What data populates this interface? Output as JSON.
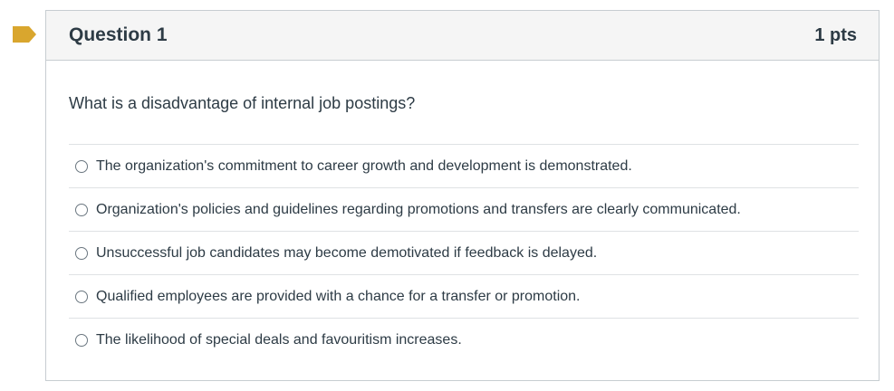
{
  "question": {
    "title": "Question 1",
    "points": "1 pts",
    "text": "What is a disadvantage of internal job postings?",
    "flag_color": "#d9a62e"
  },
  "answers": [
    {
      "label": "The organization's commitment to career growth and development is demonstrated.",
      "selected": false
    },
    {
      "label": "Organization's policies and guidelines regarding promotions and transfers are clearly communicated.",
      "selected": false
    },
    {
      "label": "Unsuccessful job candidates may become demotivated if feedback is delayed.",
      "selected": false
    },
    {
      "label": "Qualified employees are provided with a chance for a transfer or promotion.",
      "selected": false
    },
    {
      "label": "The likelihood of special deals and favouritism increases.",
      "selected": false
    }
  ]
}
